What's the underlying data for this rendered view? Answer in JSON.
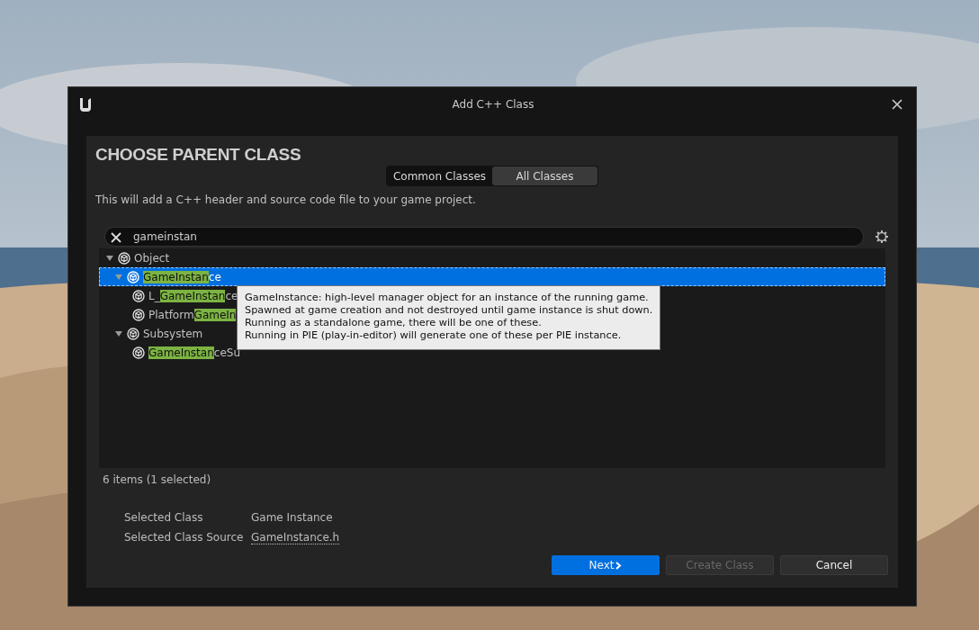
{
  "window": {
    "title": "Add C++ Class"
  },
  "heading": "CHOOSE PARENT CLASS",
  "tabs": [
    {
      "label": "Common Classes",
      "selected": false
    },
    {
      "label": "All Classes",
      "selected": true
    }
  ],
  "description": "This will add a C++ header and source code file to your game project.",
  "search": {
    "value": "gameinstan"
  },
  "tree": [
    {
      "name": "Object",
      "expanded": true,
      "selected": false,
      "children": [
        {
          "match": "GameInstan",
          "suffix": "ce",
          "expanded": true,
          "selected": true,
          "children": [
            {
              "prefix": "L_",
              "match": "GameInstan",
              "suffix": "ce",
              "selected": false
            },
            {
              "prefix": "Platform",
              "match": "GameIn",
              "selected": false
            }
          ]
        },
        {
          "name": "Subsystem",
          "expanded": true,
          "selected": false,
          "children": [
            {
              "match": "GameInstan",
              "suffix": "ceSu",
              "selected": false
            }
          ]
        }
      ]
    }
  ],
  "tooltip": [
    "GameInstance: high-level manager object for an instance of the running game.",
    "Spawned at game creation and not destroyed until game instance is shut down.",
    "Running as a standalone game, there will be one of these.",
    "Running in PIE (play-in-editor) will generate one of these per PIE instance."
  ],
  "item_count": "6 items (1 selected)",
  "details": [
    {
      "label": "Selected Class",
      "value": "Game Instance",
      "kind": "text"
    },
    {
      "label": "Selected Class Source",
      "value": "GameInstance.h",
      "kind": "link"
    }
  ],
  "buttons": [
    {
      "label": "Next",
      "kind": "primary",
      "disabled": false
    },
    {
      "label": "Create Class",
      "kind": "normal",
      "disabled": true
    },
    {
      "label": "Cancel",
      "kind": "normal",
      "disabled": false
    }
  ]
}
